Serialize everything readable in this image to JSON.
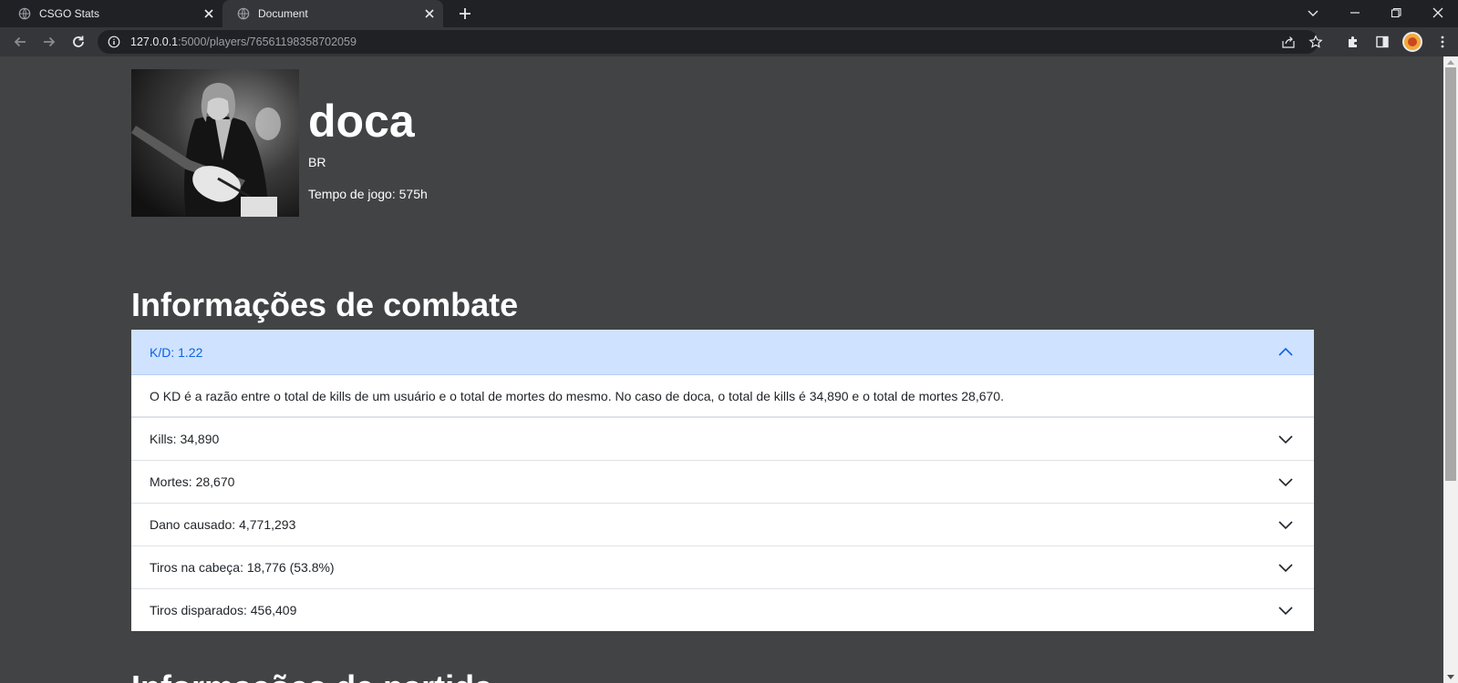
{
  "browser": {
    "tabs": [
      {
        "title": "CSGO Stats"
      },
      {
        "title": "Document"
      }
    ],
    "url_host": "127.0.0.1",
    "url_rest": ":5000/players/76561198358702059"
  },
  "player": {
    "name": "doca",
    "country": "BR",
    "playtime": "Tempo de jogo: 575h"
  },
  "combat": {
    "title": "Informações de combate",
    "items": [
      {
        "label": "K/D: 1.22",
        "expanded": true,
        "body": "O KD é a razão entre o total de kills de um usuário e o total de mortes do mesmo. No caso de doca, o total de kills é 34,890 e o total de mortes 28,670."
      },
      {
        "label": "Kills: 34,890",
        "expanded": false
      },
      {
        "label": "Mortes: 28,670",
        "expanded": false
      },
      {
        "label": "Dano causado: 4,771,293",
        "expanded": false
      },
      {
        "label": "Tiros na cabeça: 18,776 (53.8%)",
        "expanded": false
      },
      {
        "label": "Tiros disparados: 456,409",
        "expanded": false
      }
    ]
  },
  "match": {
    "title": "Informações de partida"
  },
  "colors": {
    "page_bg": "#424344",
    "accordion_open_bg": "#cfe2ff",
    "accordion_open_text": "#0c63e4"
  }
}
